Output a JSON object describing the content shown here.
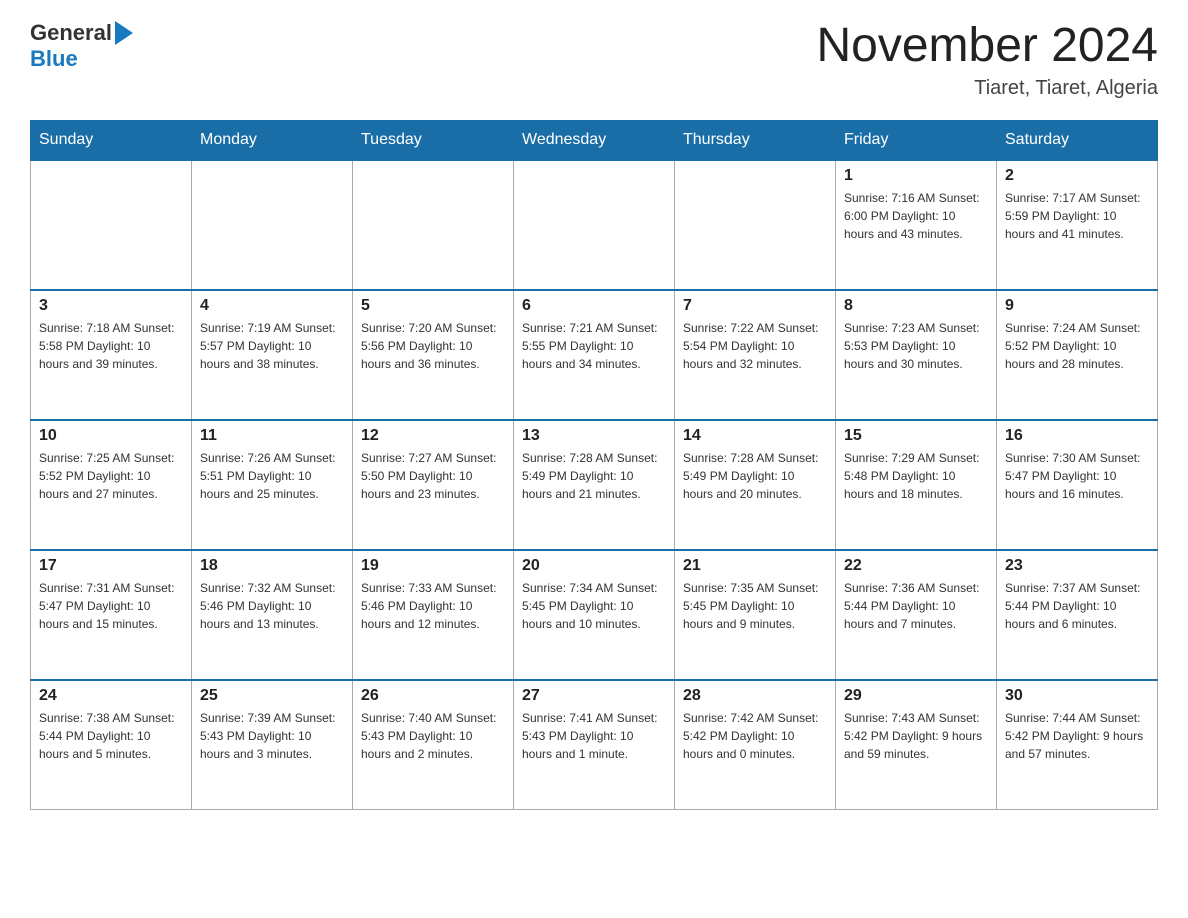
{
  "header": {
    "logo_general": "General",
    "logo_blue": "Blue",
    "month_title": "November 2024",
    "location": "Tiaret, Tiaret, Algeria"
  },
  "weekdays": [
    "Sunday",
    "Monday",
    "Tuesday",
    "Wednesday",
    "Thursday",
    "Friday",
    "Saturday"
  ],
  "weeks": [
    [
      {
        "day": "",
        "info": ""
      },
      {
        "day": "",
        "info": ""
      },
      {
        "day": "",
        "info": ""
      },
      {
        "day": "",
        "info": ""
      },
      {
        "day": "",
        "info": ""
      },
      {
        "day": "1",
        "info": "Sunrise: 7:16 AM\nSunset: 6:00 PM\nDaylight: 10 hours and 43 minutes."
      },
      {
        "day": "2",
        "info": "Sunrise: 7:17 AM\nSunset: 5:59 PM\nDaylight: 10 hours and 41 minutes."
      }
    ],
    [
      {
        "day": "3",
        "info": "Sunrise: 7:18 AM\nSunset: 5:58 PM\nDaylight: 10 hours and 39 minutes."
      },
      {
        "day": "4",
        "info": "Sunrise: 7:19 AM\nSunset: 5:57 PM\nDaylight: 10 hours and 38 minutes."
      },
      {
        "day": "5",
        "info": "Sunrise: 7:20 AM\nSunset: 5:56 PM\nDaylight: 10 hours and 36 minutes."
      },
      {
        "day": "6",
        "info": "Sunrise: 7:21 AM\nSunset: 5:55 PM\nDaylight: 10 hours and 34 minutes."
      },
      {
        "day": "7",
        "info": "Sunrise: 7:22 AM\nSunset: 5:54 PM\nDaylight: 10 hours and 32 minutes."
      },
      {
        "day": "8",
        "info": "Sunrise: 7:23 AM\nSunset: 5:53 PM\nDaylight: 10 hours and 30 minutes."
      },
      {
        "day": "9",
        "info": "Sunrise: 7:24 AM\nSunset: 5:52 PM\nDaylight: 10 hours and 28 minutes."
      }
    ],
    [
      {
        "day": "10",
        "info": "Sunrise: 7:25 AM\nSunset: 5:52 PM\nDaylight: 10 hours and 27 minutes."
      },
      {
        "day": "11",
        "info": "Sunrise: 7:26 AM\nSunset: 5:51 PM\nDaylight: 10 hours and 25 minutes."
      },
      {
        "day": "12",
        "info": "Sunrise: 7:27 AM\nSunset: 5:50 PM\nDaylight: 10 hours and 23 minutes."
      },
      {
        "day": "13",
        "info": "Sunrise: 7:28 AM\nSunset: 5:49 PM\nDaylight: 10 hours and 21 minutes."
      },
      {
        "day": "14",
        "info": "Sunrise: 7:28 AM\nSunset: 5:49 PM\nDaylight: 10 hours and 20 minutes."
      },
      {
        "day": "15",
        "info": "Sunrise: 7:29 AM\nSunset: 5:48 PM\nDaylight: 10 hours and 18 minutes."
      },
      {
        "day": "16",
        "info": "Sunrise: 7:30 AM\nSunset: 5:47 PM\nDaylight: 10 hours and 16 minutes."
      }
    ],
    [
      {
        "day": "17",
        "info": "Sunrise: 7:31 AM\nSunset: 5:47 PM\nDaylight: 10 hours and 15 minutes."
      },
      {
        "day": "18",
        "info": "Sunrise: 7:32 AM\nSunset: 5:46 PM\nDaylight: 10 hours and 13 minutes."
      },
      {
        "day": "19",
        "info": "Sunrise: 7:33 AM\nSunset: 5:46 PM\nDaylight: 10 hours and 12 minutes."
      },
      {
        "day": "20",
        "info": "Sunrise: 7:34 AM\nSunset: 5:45 PM\nDaylight: 10 hours and 10 minutes."
      },
      {
        "day": "21",
        "info": "Sunrise: 7:35 AM\nSunset: 5:45 PM\nDaylight: 10 hours and 9 minutes."
      },
      {
        "day": "22",
        "info": "Sunrise: 7:36 AM\nSunset: 5:44 PM\nDaylight: 10 hours and 7 minutes."
      },
      {
        "day": "23",
        "info": "Sunrise: 7:37 AM\nSunset: 5:44 PM\nDaylight: 10 hours and 6 minutes."
      }
    ],
    [
      {
        "day": "24",
        "info": "Sunrise: 7:38 AM\nSunset: 5:44 PM\nDaylight: 10 hours and 5 minutes."
      },
      {
        "day": "25",
        "info": "Sunrise: 7:39 AM\nSunset: 5:43 PM\nDaylight: 10 hours and 3 minutes."
      },
      {
        "day": "26",
        "info": "Sunrise: 7:40 AM\nSunset: 5:43 PM\nDaylight: 10 hours and 2 minutes."
      },
      {
        "day": "27",
        "info": "Sunrise: 7:41 AM\nSunset: 5:43 PM\nDaylight: 10 hours and 1 minute."
      },
      {
        "day": "28",
        "info": "Sunrise: 7:42 AM\nSunset: 5:42 PM\nDaylight: 10 hours and 0 minutes."
      },
      {
        "day": "29",
        "info": "Sunrise: 7:43 AM\nSunset: 5:42 PM\nDaylight: 9 hours and 59 minutes."
      },
      {
        "day": "30",
        "info": "Sunrise: 7:44 AM\nSunset: 5:42 PM\nDaylight: 9 hours and 57 minutes."
      }
    ]
  ]
}
